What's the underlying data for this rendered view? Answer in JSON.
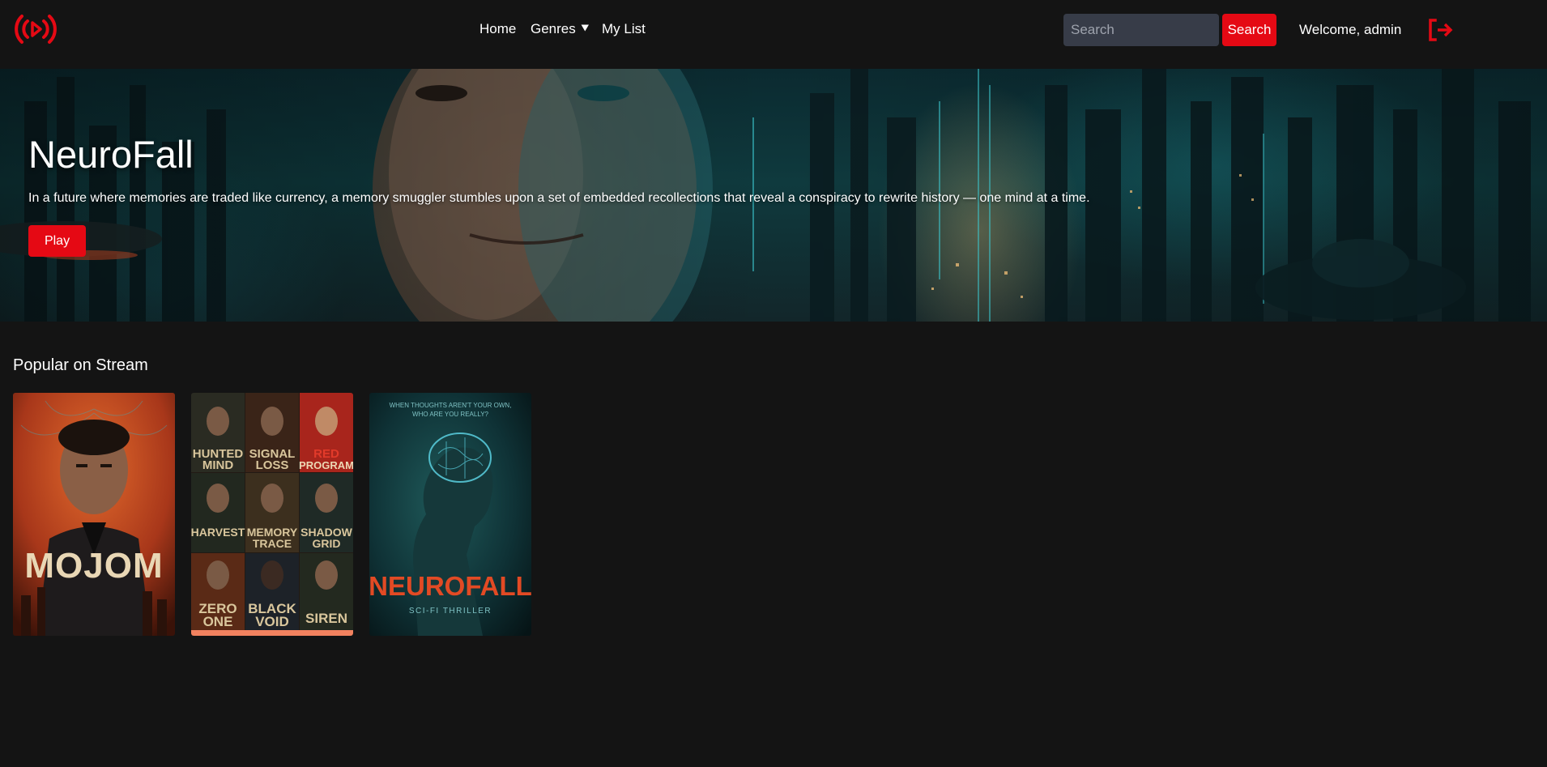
{
  "nav": {
    "home": "Home",
    "genres": "Genres ⯆",
    "my_list": "My List",
    "search_placeholder": "Search",
    "search_button": "Search",
    "welcome": "Welcome, admin"
  },
  "icons": {
    "logo": "broadcast-play-icon",
    "logout": "logout-icon"
  },
  "colors": {
    "accent": "#e50914",
    "background": "#141414",
    "search_field": "#373c48",
    "hover_bar": "#f2825f"
  },
  "hero": {
    "title": "NeuroFall",
    "description": "In a future where memories are traded like currency, a memory smuggler stumbles upon a set of embedded recollections that reveal a conspiracy to rewrite history — one mind at a time.",
    "play": "Play"
  },
  "popular": {
    "title": "Popular on Stream",
    "posters": [
      {
        "title": "MOJOM"
      },
      {
        "tiles": [
          [
            "HUNTED",
            "MIND"
          ],
          [
            "SIGNAL",
            "LOSS"
          ],
          [
            "RED",
            "PROGRAM"
          ],
          [
            "HARVEST"
          ],
          [
            "MEMORY",
            "TRACE"
          ],
          [
            "SHADOW",
            "GRID"
          ],
          [
            "ZERO",
            "ONE"
          ],
          [
            "BLACK",
            "VOID"
          ],
          [
            "SIREN"
          ]
        ]
      },
      {
        "tagline_1": "WHEN THOUGHTS AREN'T YOUR OWN,",
        "tagline_2": "WHO ARE YOU REALLY?",
        "title": "NEUROFALL",
        "subtitle": "SCI-FI THRILLER"
      }
    ]
  }
}
